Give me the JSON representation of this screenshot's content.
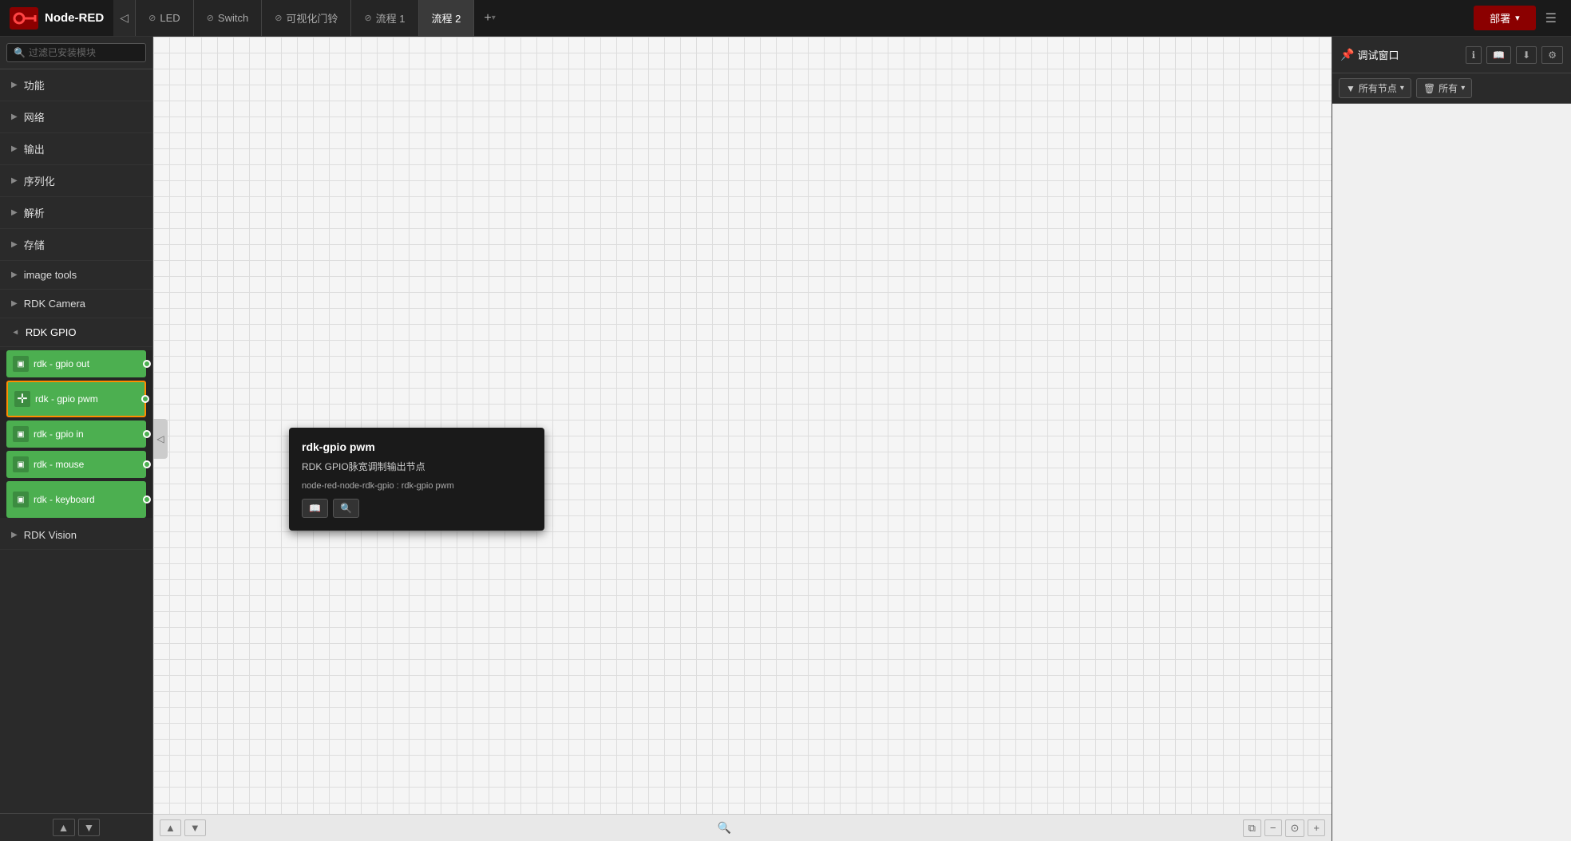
{
  "topbar": {
    "logo_text": "Node-RED",
    "deploy_label": "部署",
    "deploy_chevron": "▾",
    "menu_icon": "☰",
    "tabs": [
      {
        "id": "tab-hidden",
        "label": "",
        "icon": "◁",
        "active": false,
        "hidden": true
      },
      {
        "id": "tab-led",
        "label": "LED",
        "icon": "⊘",
        "active": false
      },
      {
        "id": "tab-switch",
        "label": "Switch",
        "icon": "⊘",
        "active": false
      },
      {
        "id": "tab-bell",
        "label": "可视化门铃",
        "icon": "⊘",
        "active": false
      },
      {
        "id": "tab-flow1",
        "label": "流程 1",
        "icon": "⊘",
        "active": false
      },
      {
        "id": "tab-flow2",
        "label": "流程 2",
        "active": true
      }
    ],
    "tab_add": "+",
    "tab_add_chevron": "▾"
  },
  "panel_right": {
    "title": "调试窗口",
    "pin_icon": "📌",
    "filter_label": "所有节点",
    "all_label": "所有",
    "icons": {
      "info": "ℹ",
      "book": "📖",
      "download": "⬇",
      "gear": "⚙"
    }
  },
  "sidebar_left": {
    "search_placeholder": "过滤已安装模块",
    "categories": [
      {
        "label": "功能",
        "expanded": false
      },
      {
        "label": "网络",
        "expanded": false
      },
      {
        "label": "输出",
        "expanded": false
      },
      {
        "label": "序列化",
        "expanded": false
      },
      {
        "label": "解析",
        "expanded": false
      },
      {
        "label": "存储",
        "expanded": false
      },
      {
        "label": "image tools",
        "expanded": false
      },
      {
        "label": "RDK Camera",
        "expanded": false
      },
      {
        "label": "RDK GPIO",
        "expanded": true
      }
    ],
    "nodes": [
      {
        "label": "rdk - gpio out",
        "has_right_port": true,
        "selected": false
      },
      {
        "label": "rdk - gpio pwm",
        "has_right_port": true,
        "selected": true,
        "double_height": true
      },
      {
        "label": "rdk - gpio in",
        "has_right_port": true,
        "selected": false
      },
      {
        "label": "rdk - mouse",
        "has_right_port": true,
        "selected": false
      },
      {
        "label": "rdk - keyboard",
        "has_right_port": true,
        "selected": false
      }
    ],
    "bottom_icons": [
      "▲",
      "▼"
    ],
    "last_category": "RDK Vision"
  },
  "tooltip": {
    "title": "rdk-gpio pwm",
    "description": "RDK GPIO脉宽调制输出节点",
    "module": "node-red-node-rdk-gpio : rdk-gpio pwm",
    "btn_book": "📖",
    "btn_search": "🔍"
  },
  "canvas": {
    "collapse_icon": "◁",
    "bottom": {
      "up_icon": "▲",
      "down_icon": "▼",
      "search_icon": "🔍",
      "zoom_out": "−",
      "zoom_reset": "⊙",
      "zoom_in": "+"
    }
  }
}
